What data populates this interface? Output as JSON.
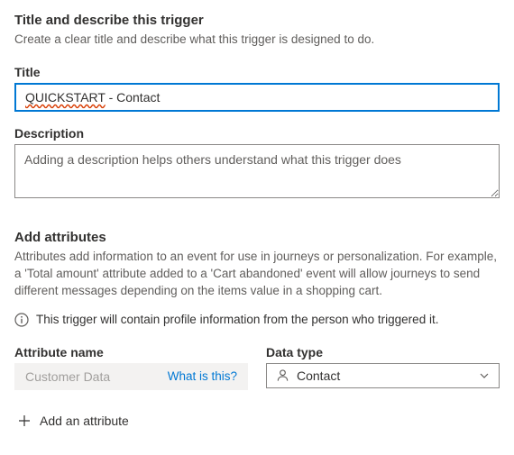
{
  "section1": {
    "heading": "Title and describe this trigger",
    "subtext": "Create a clear title and describe what this trigger is designed to do."
  },
  "title_field": {
    "label": "Title",
    "value_part1": "QUICKSTART",
    "value_part2": " - Contact"
  },
  "description_field": {
    "label": "Description",
    "placeholder": "Adding a description helps others understand what this trigger does"
  },
  "section2": {
    "heading": "Add attributes",
    "subtext": "Attributes add information to an event for use in journeys or personalization. For example, a 'Total amount' attribute added to a 'Cart abandoned' event will allow journeys to send different messages depending on the items value in a shopping cart."
  },
  "info_note": "This trigger will contain profile information from the person who triggered it.",
  "attribute": {
    "name_label": "Attribute name",
    "name_value": "Customer Data",
    "what_is": "What is this?",
    "type_label": "Data type",
    "type_value": "Contact"
  },
  "add_attribute_label": "Add an attribute"
}
